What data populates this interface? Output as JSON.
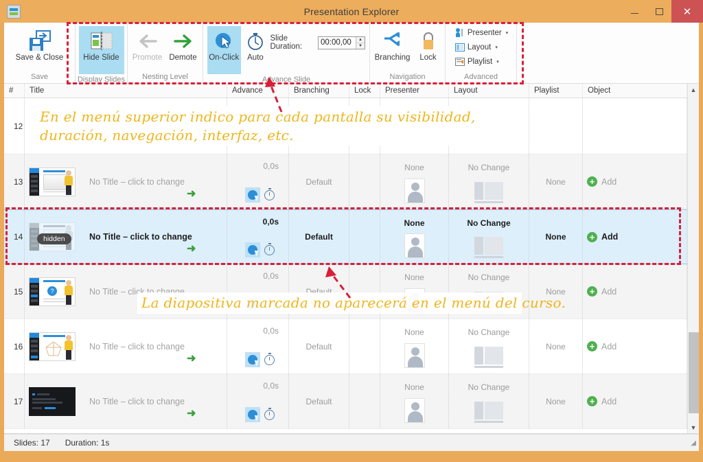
{
  "window": {
    "title": "Presentation Explorer",
    "icon": "presentation-icon",
    "minimize": "–",
    "maximize": "□",
    "close": "✕"
  },
  "ribbon": {
    "groups": [
      {
        "title": "Save",
        "buttons": [
          {
            "label": "Save & Close",
            "icon": "save-close-icon",
            "state": "normal"
          }
        ]
      },
      {
        "title": "Display Slides",
        "buttons": [
          {
            "label": "Hide Slide",
            "icon": "hide-slide-icon",
            "state": "active"
          }
        ]
      },
      {
        "title": "Nesting Level",
        "buttons": [
          {
            "label": "Promote",
            "icon": "arrow-left-icon",
            "state": "disabled"
          },
          {
            "label": "Demote",
            "icon": "arrow-right-icon",
            "state": "normal"
          }
        ]
      },
      {
        "title": "Advance Slide",
        "buttons": [
          {
            "label": "On-Click",
            "icon": "cursor-click-icon",
            "state": "active"
          },
          {
            "label": "Auto",
            "icon": "stopwatch-icon",
            "state": "normal"
          }
        ],
        "duration_label": "Slide Duration:",
        "duration_value": "00:00,00"
      },
      {
        "title": "Navigation",
        "buttons": [
          {
            "label": "Branching",
            "icon": "branching-icon",
            "state": "normal"
          },
          {
            "label": "Lock",
            "icon": "lock-icon",
            "state": "normal"
          }
        ]
      },
      {
        "title": "Advanced",
        "menu_items": [
          {
            "label": "Presenter",
            "icon": "presenter-icon",
            "caret": "▾"
          },
          {
            "label": "Layout",
            "icon": "layout-icon",
            "caret": "▾"
          },
          {
            "label": "Playlist",
            "icon": "playlist-icon",
            "caret": "▾"
          }
        ]
      }
    ]
  },
  "table": {
    "columns": [
      {
        "key": "num",
        "label": "#"
      },
      {
        "key": "title",
        "label": "Title"
      },
      {
        "key": "advance",
        "label": "Advance"
      },
      {
        "key": "branching",
        "label": "Branching"
      },
      {
        "key": "lock",
        "label": "Lock"
      },
      {
        "key": "presenter",
        "label": "Presenter"
      },
      {
        "key": "layout",
        "label": "Layout"
      },
      {
        "key": "playlist",
        "label": "Playlist"
      },
      {
        "key": "object",
        "label": "Object"
      }
    ],
    "rows": [
      {
        "num": "12",
        "title": "",
        "advance_time": "",
        "branching": "",
        "presenter": "",
        "layout": "",
        "playlist": "",
        "object": "",
        "annotation_row": true,
        "selected": false,
        "hidden": false
      },
      {
        "num": "13",
        "title": "No Title – click to change",
        "advance_time": "0,0s",
        "branching": "Default",
        "presenter": "None",
        "layout": "No Change",
        "playlist": "None",
        "object": "Add",
        "annotation_row": false,
        "selected": false,
        "hidden": false,
        "thumb": "screen-presenter"
      },
      {
        "num": "14",
        "title": "No Title – click to change",
        "advance_time": "0,0s",
        "branching": "Default",
        "presenter": "None",
        "layout": "No Change",
        "playlist": "None",
        "object": "Add",
        "annotation_row": false,
        "selected": true,
        "hidden": true,
        "hidden_badge": "hidden",
        "thumb": "screen-presenter"
      },
      {
        "num": "15",
        "title": "No Title – click to change",
        "advance_time": "0,0s",
        "branching": "Default",
        "presenter": "None",
        "layout": "No Change",
        "playlist": "None",
        "object": "Add",
        "annotation_row": false,
        "selected": false,
        "hidden": false,
        "thumb": "quiz-presenter"
      },
      {
        "num": "16",
        "title": "No Title – click to change",
        "advance_time": "0,0s",
        "branching": "Default",
        "presenter": "None",
        "layout": "No Change",
        "playlist": "None",
        "object": "Add",
        "annotation_row": false,
        "selected": false,
        "hidden": false,
        "thumb": "diagram-presenter"
      },
      {
        "num": "17",
        "title": "No Title – click to change",
        "advance_time": "0,0s",
        "branching": "Default",
        "presenter": "None",
        "layout": "No Change",
        "playlist": "None",
        "object": "Add",
        "annotation_row": false,
        "selected": false,
        "hidden": false,
        "thumb": "dark-slide"
      }
    ]
  },
  "annotations": [
    {
      "id": "annotation-top",
      "text": "En el menú superior indico para cada pantalla su visibilidad, duración, navegación, interfaz, etc."
    },
    {
      "id": "annotation-bottom",
      "text": "La diapositiva marcada no aparecerá en el menú del curso."
    }
  ],
  "statusbar": {
    "slides": "Slides: 17",
    "duration": "Duration:  1s"
  },
  "colors": {
    "window_chrome": "#ecad5d",
    "accent_blue": "#2d8fd8",
    "highlight_row": "#ddeffb",
    "annotation": "#eeb51b",
    "callout_red": "#d81f3a",
    "close_button": "#cc5254",
    "green": "#4fb04f"
  }
}
